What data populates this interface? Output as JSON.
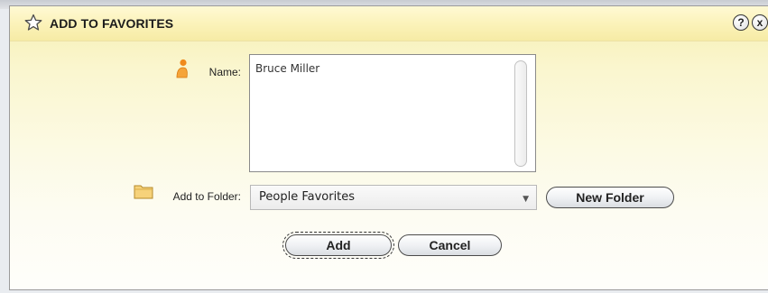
{
  "dialog": {
    "title": "ADD TO FAVORITES",
    "help_label": "?",
    "close_label": "x"
  },
  "form": {
    "name_label": "Name:",
    "name_value": "Bruce  Miller",
    "folder_label": "Add to Folder:",
    "folder_selected": "People Favorites",
    "new_folder_label": "New Folder"
  },
  "actions": {
    "add_label": "Add",
    "cancel_label": "Cancel"
  },
  "colors": {
    "title_bar": "#fbf2b8",
    "person_icon": "#f39a2b",
    "folder_icon": "#f6d27a"
  }
}
